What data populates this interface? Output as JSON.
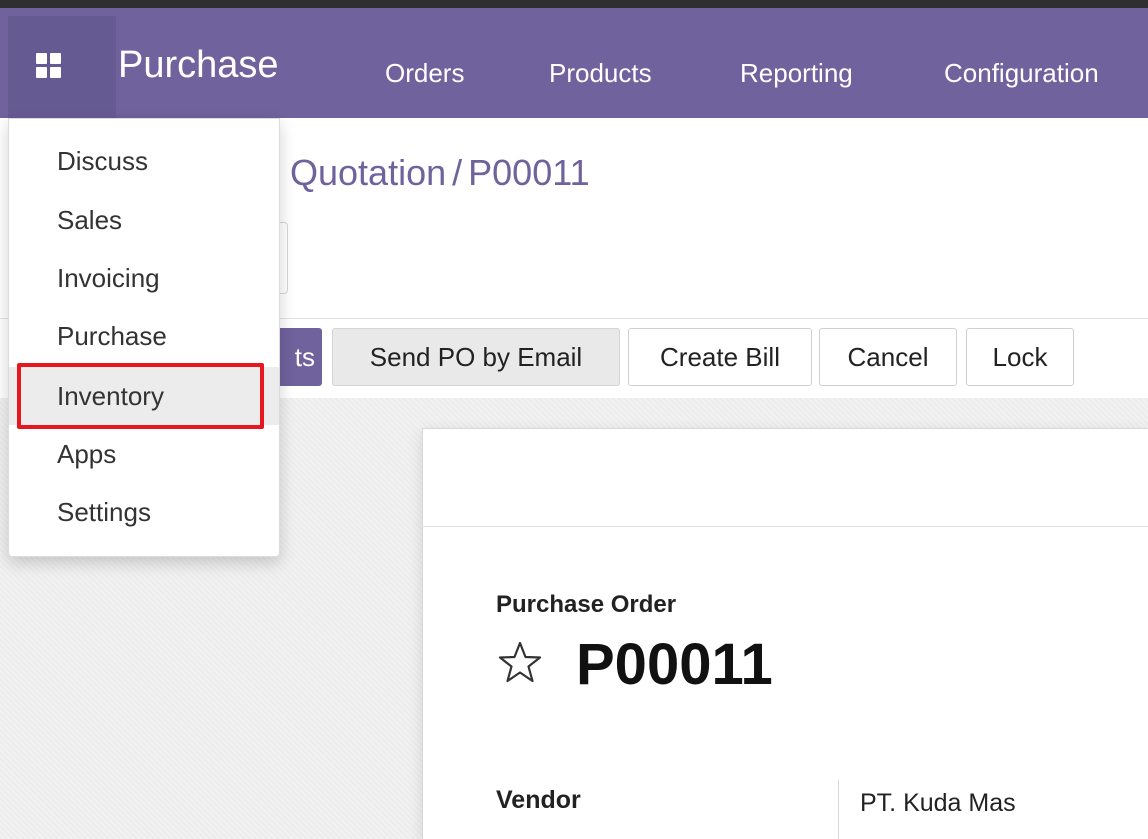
{
  "navbar": {
    "app_name": "Purchase",
    "menu": [
      "Orders",
      "Products",
      "Reporting",
      "Configuration"
    ],
    "bg_color": "#6f629d"
  },
  "apps_menu": {
    "items": [
      "Discuss",
      "Sales",
      "Invoicing",
      "Purchase",
      "Inventory",
      "Apps",
      "Settings"
    ],
    "highlighted_item": "Inventory",
    "highlight_color": "#e8161f"
  },
  "breadcrumb": {
    "parent": "Quotation",
    "separator": "/",
    "current": "P00011"
  },
  "buttons": {
    "partial_primary": "ts",
    "send_po": "Send PO by Email",
    "create_bill": "Create Bill",
    "cancel": "Cancel",
    "lock": "Lock"
  },
  "form": {
    "doc_type": "Purchase Order",
    "number": "P00011",
    "vendor_label": "Vendor",
    "vendor_value": "PT. Kuda Mas"
  },
  "icons": {
    "app_switcher": "grid-icon",
    "favorite": "star-outline-icon"
  }
}
